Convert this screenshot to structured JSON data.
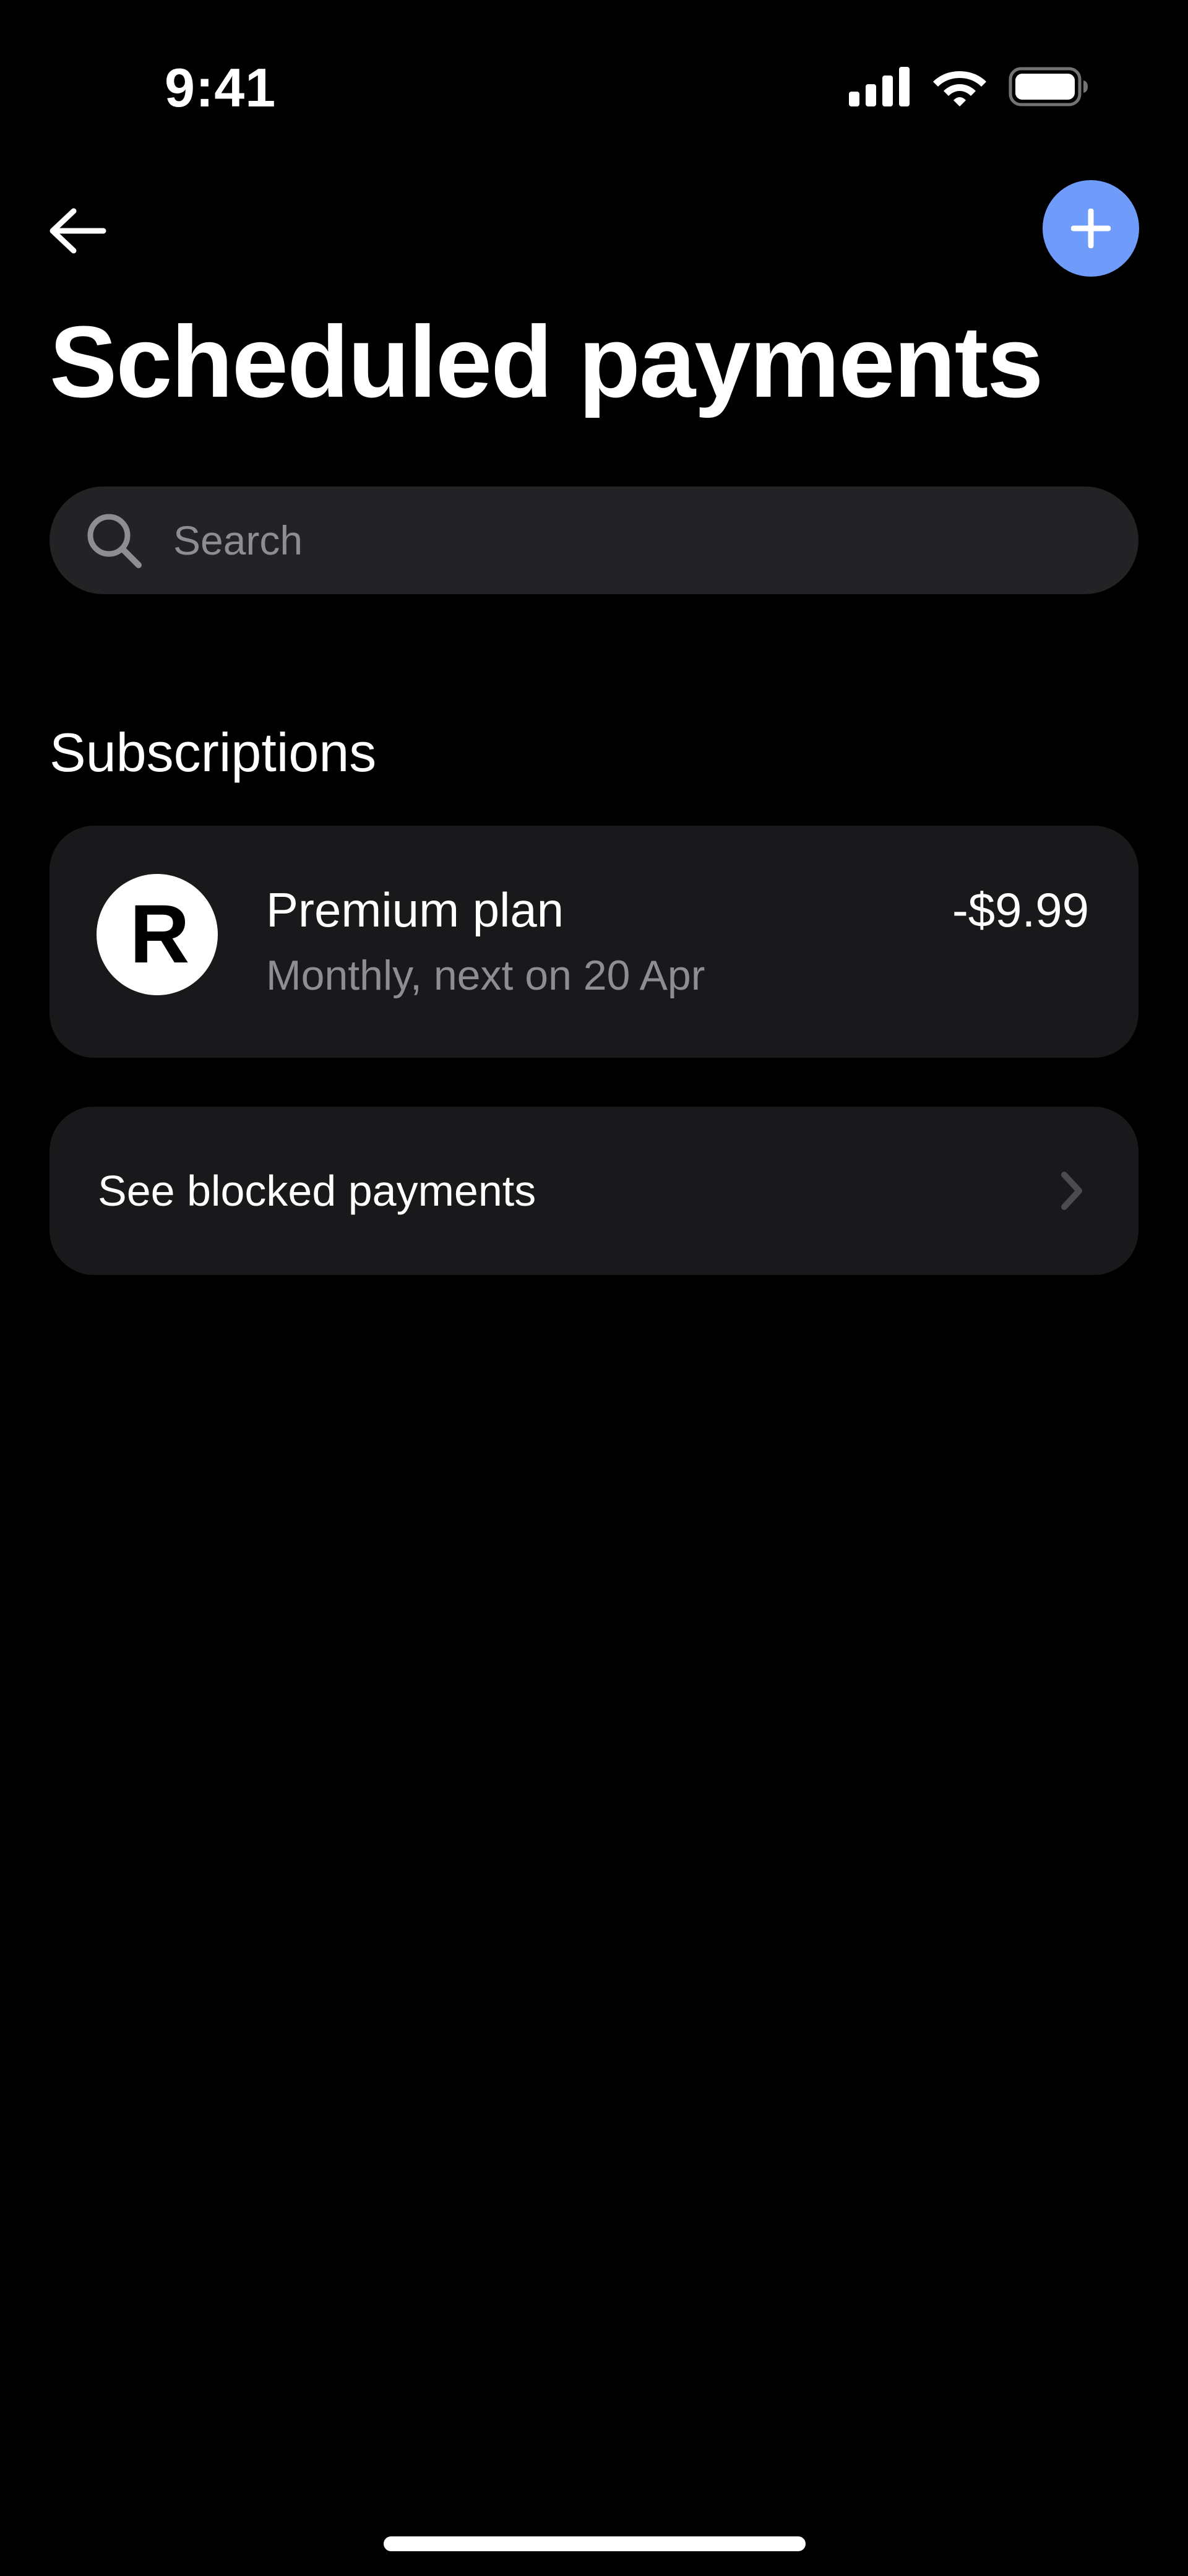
{
  "status_bar": {
    "time": "9:41"
  },
  "nav": {
    "back_icon": "arrow-left-icon",
    "add_icon": "plus-icon"
  },
  "header": {
    "title": "Scheduled payments"
  },
  "search": {
    "placeholder": "Search",
    "value": ""
  },
  "subscriptions": {
    "section_title": "Subscriptions",
    "items": [
      {
        "logo_letter": "R",
        "name": "Premium plan",
        "schedule": "Monthly, next on 20 Apr",
        "amount": "-$9.99"
      }
    ]
  },
  "blocked": {
    "label": "See blocked payments"
  },
  "colors": {
    "background": "#000000",
    "card": "#19191b",
    "search_bg": "#232326",
    "accent": "#6f9bfb",
    "secondary_text": "#8d8d93"
  }
}
